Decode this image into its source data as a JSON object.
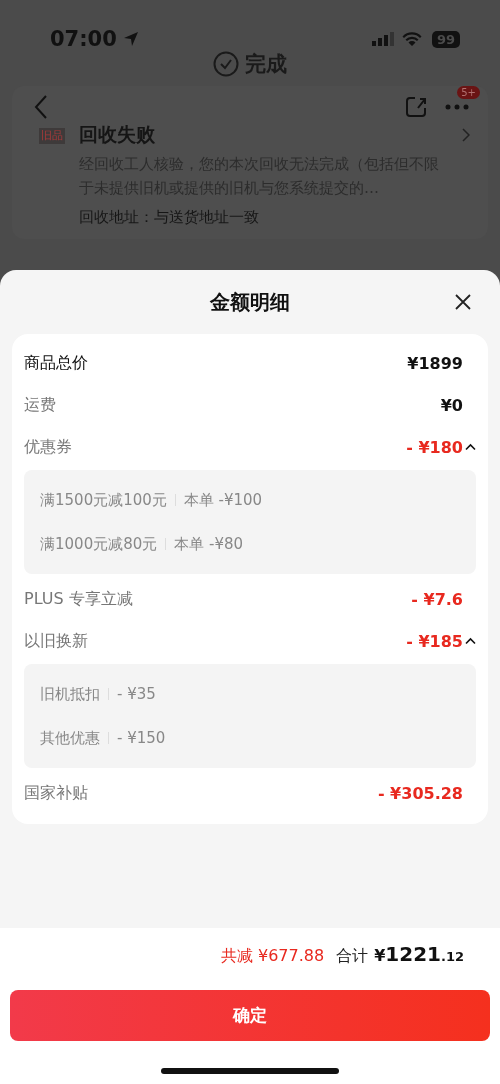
{
  "status_bar": {
    "time": "07:00",
    "battery": "99"
  },
  "done_pill": {
    "label": "完成"
  },
  "nav": {
    "badge": "5+"
  },
  "recycle_card": {
    "tag": "旧品",
    "title": "回收失败",
    "description": "经回收工人核验，您的本次回收无法完成（包括但不限于未提供旧机或提供的旧机与您系统提交的…",
    "address": "回收地址：与送货地址一致"
  },
  "sheet": {
    "title": "金额明细",
    "rows": [
      {
        "kind": "total",
        "label": "商品总价",
        "value": "¥1899"
      },
      {
        "kind": "fee",
        "label": "运费",
        "value": "¥0"
      },
      {
        "kind": "discount",
        "label": "优惠券",
        "value": "- ¥180",
        "expanded": true,
        "details": [
          {
            "label": "满1500元减100元",
            "value": "本单 -¥100"
          },
          {
            "label": "满1000元减80元",
            "value": "本单 -¥80"
          }
        ]
      },
      {
        "kind": "discount",
        "label": "PLUS 专享立减",
        "value": "- ¥7.6"
      },
      {
        "kind": "discount",
        "label": "以旧换新",
        "value": "- ¥185",
        "expanded": true,
        "details": [
          {
            "label": "旧机抵扣",
            "value": "- ¥35"
          },
          {
            "label": "其他优惠",
            "value": "- ¥150"
          }
        ]
      },
      {
        "kind": "discount",
        "label": "国家补贴",
        "value": "- ¥305.28"
      }
    ]
  },
  "summary": {
    "saved": "共减 ¥677.88",
    "total_label": "合计",
    "total_currency": "¥",
    "total_integer": "1221",
    "total_decimal": ".12"
  },
  "confirm_button": {
    "label": "确定"
  }
}
